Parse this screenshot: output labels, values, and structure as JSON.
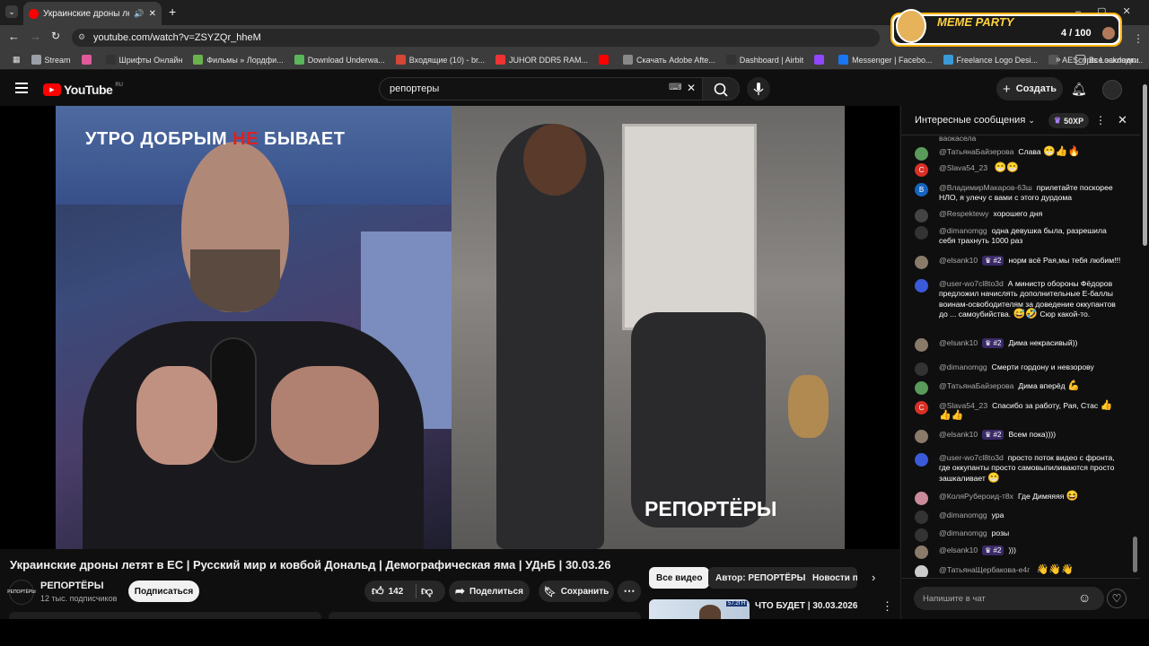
{
  "browser": {
    "tab_title": "Украинские дроны летят в",
    "url": "youtube.com/watch?v=ZSYZQr_hheM",
    "bookmarks": [
      {
        "label": "Stream",
        "color": "#9aa0a6"
      },
      {
        "label": "",
        "color": "#e05a9a"
      },
      {
        "label": "Шрифты Онлайн",
        "color": "#333"
      },
      {
        "label": "Фильмы » Лордфи...",
        "color": "#6ab04c"
      },
      {
        "label": "Download Underwa...",
        "color": "#5ab65a"
      },
      {
        "label": "Входящие (10) - br...",
        "color": "#d44638"
      },
      {
        "label": "JUHOR DDR5 RAM...",
        "color": "#e33"
      },
      {
        "label": "",
        "color": "#ff0000"
      },
      {
        "label": "Скачать Adobe Afte...",
        "color": "#888"
      },
      {
        "label": "Dashboard | Airbit",
        "color": "#333"
      },
      {
        "label": "",
        "color": "#9146ff"
      },
      {
        "label": "Messenger | Facebo...",
        "color": "#1877f2"
      },
      {
        "label": "Freelance Logo Desi...",
        "color": "#3a9ad9"
      },
      {
        "label": "AEScripts Lockdown...",
        "color": "#555"
      }
    ],
    "all_bookmarks": "Все закладки"
  },
  "meme_party": {
    "label": "MEME PARTY",
    "counter": "4 / 100"
  },
  "youtube": {
    "logo": "YouTube",
    "logo_region": "RU",
    "search_value": "репортеры",
    "create_label": "Создать"
  },
  "video": {
    "banner_pre": "УТРО ДОБРЫМ ",
    "banner_ne": "НЕ",
    "banner_post": " БЫВАЕТ",
    "watermark": "РЕПОРТЁРЫ",
    "title": "Украинские дроны летят в ЕС | Русский мир и ковбой Дональд | Демографическая яма | УДнБ | 30.03.26",
    "channel": "РЕПОРТЁРЫ",
    "channel_avatar_text": "РЕПОРТЁРЫ",
    "subscribers": "12 тыс. подписчиков",
    "subscribe": "Подписаться",
    "likes": "142",
    "share": "Поделиться",
    "save": "Сохранить"
  },
  "chips": [
    "Все видео",
    "Автор: РЕПОРТЁРЫ",
    "Новости по"
  ],
  "recommended": {
    "title": "ЧТО БУДЕТ | 30.03.2026",
    "thumb_text": "57.2ГН"
  },
  "chat": {
    "header": "Интересные сообщения",
    "xp": "50XP",
    "input_placeholder": "Напишите в чат",
    "top_fragment": "ваокасела",
    "messages": [
      {
        "author": "@ТатьянаБайзерова",
        "text": "Слава",
        "emoji": "😁👍🔥",
        "badge": "",
        "av": "#5a9a5a",
        "av_letter": ""
      },
      {
        "author": "@Slava54_23",
        "text": "",
        "emoji": "😁😁",
        "badge": "",
        "av": "#d93025",
        "av_letter": "С"
      },
      {
        "author": "@ВладимирМакаров-63ш",
        "text": "прилетайте поскорее НЛО, я улечу с вами с этого дурдома",
        "emoji": "",
        "badge": "",
        "av": "#1565c0",
        "av_letter": "В"
      },
      {
        "author": "@Respektewy",
        "text": "хорошего дня",
        "emoji": "",
        "badge": "",
        "av": "#444",
        "av_letter": ""
      },
      {
        "author": "@dimanomgg",
        "text": "одна девушка была, разрешила себя трахнуть 1000 раз",
        "emoji": "",
        "badge": "",
        "av": "#333",
        "av_letter": ""
      },
      {
        "author": "@elsank10",
        "text": "норм всё Рая,мы тебя любим!!!",
        "emoji": "",
        "badge": "#2",
        "av": "#8a7a6a",
        "av_letter": ""
      },
      {
        "author": "@user-wo7cl8to3d",
        "text": "А министр обороны Фёдоров предложил начислять дополнительные Е-баллы воинам-освободителям за доведение оккупантов до ... самоубийства.",
        "emoji": "😅🤣",
        "tail": "Сюр какой-то.",
        "badge": "",
        "av": "#3a5ad9",
        "av_letter": ""
      },
      {
        "author": "@elsank10",
        "text": "Дима некрасивый))",
        "emoji": "",
        "badge": "#2",
        "av": "#8a7a6a",
        "av_letter": ""
      },
      {
        "author": "@dimanomgg",
        "text": "Смерти гордону и невзорову",
        "emoji": "",
        "badge": "",
        "av": "#333",
        "av_letter": ""
      },
      {
        "author": "@ТатьянаБайзерова",
        "text": "Дима вперёд",
        "emoji": "💪",
        "badge": "",
        "av": "#5a9a5a",
        "av_letter": ""
      },
      {
        "author": "@Slava54_23",
        "text": "Спасибо за работу, Рая, Стас",
        "emoji": "👍👍👍",
        "badge": "",
        "av": "#d93025",
        "av_letter": "С"
      },
      {
        "author": "@elsank10",
        "text": "Всем пока))))",
        "emoji": "",
        "badge": "#2",
        "av": "#8a7a6a",
        "av_letter": ""
      },
      {
        "author": "@user-wo7cl8to3d",
        "text": "просто поток видео с фронта, где оккупанты просто самовыпиливаются просто зашкаливает",
        "emoji": "😁",
        "badge": "",
        "av": "#3a5ad9",
        "av_letter": ""
      },
      {
        "author": "@КоляРубероид-т8х",
        "text": "Где Димяяяя",
        "emoji": "😆",
        "badge": "",
        "av": "#c98a9a",
        "av_letter": ""
      },
      {
        "author": "@dimanomgg",
        "text": "ура",
        "emoji": "",
        "badge": "",
        "av": "#333",
        "av_letter": ""
      },
      {
        "author": "@dimanomgg",
        "text": "розы",
        "emoji": "",
        "badge": "",
        "av": "#333",
        "av_letter": ""
      },
      {
        "author": "@elsank10",
        "text": ")))",
        "emoji": "",
        "badge": "#2",
        "av": "#8a7a6a",
        "av_letter": ""
      },
      {
        "author": "@ТатьянаЩербакова-е4г",
        "text": "",
        "emoji": "👋👋👋",
        "badge": "",
        "av": "#ccc",
        "av_letter": ""
      }
    ]
  }
}
